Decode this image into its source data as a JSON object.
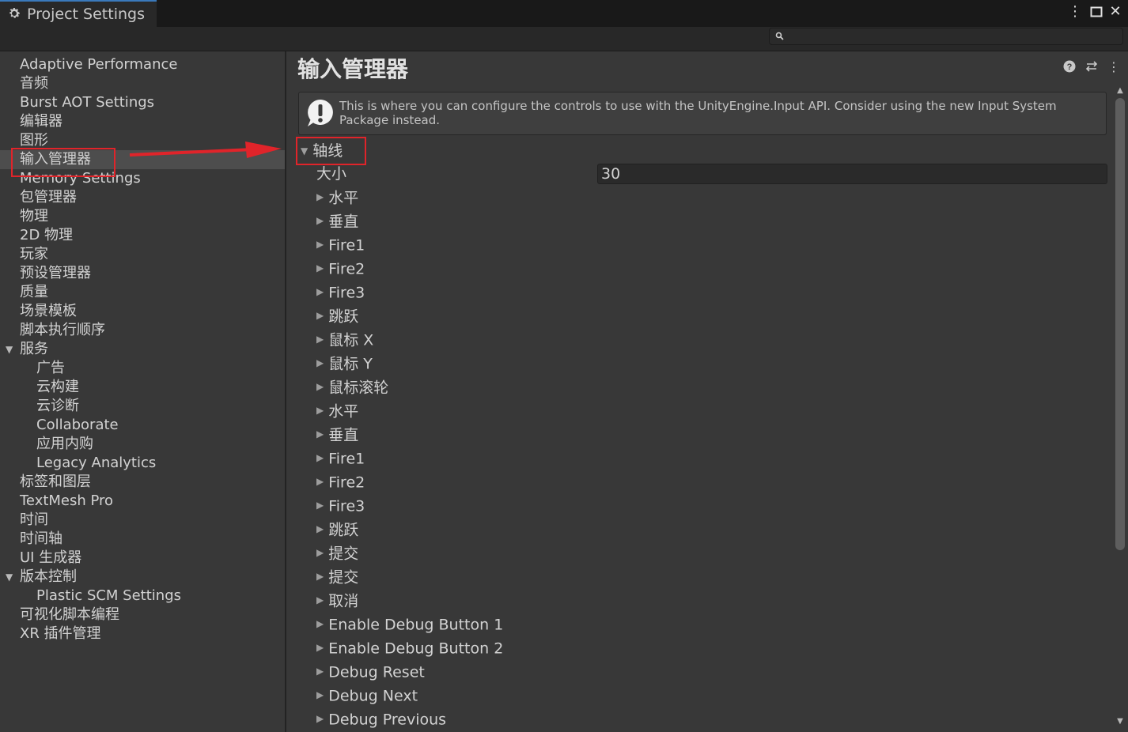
{
  "window": {
    "title": "Project Settings",
    "menu_icon": "more-vertical-icon",
    "maximize_icon": "maximize-icon",
    "close_icon": "close-icon"
  },
  "search": {
    "placeholder": "",
    "icon": "search-icon"
  },
  "sidebar": {
    "selected_index": 5,
    "items": [
      {
        "label": "Adaptive Performance",
        "level": 0
      },
      {
        "label": "音频",
        "level": 0
      },
      {
        "label": "Burst AOT Settings",
        "level": 0
      },
      {
        "label": "编辑器",
        "level": 0
      },
      {
        "label": "图形",
        "level": 0
      },
      {
        "label": "输入管理器",
        "level": 0,
        "selected": true
      },
      {
        "label": "Memory Settings",
        "level": 0
      },
      {
        "label": "包管理器",
        "level": 0
      },
      {
        "label": "物理",
        "level": 0
      },
      {
        "label": "2D 物理",
        "level": 0
      },
      {
        "label": "玩家",
        "level": 0
      },
      {
        "label": "预设管理器",
        "level": 0
      },
      {
        "label": "质量",
        "level": 0
      },
      {
        "label": "场景模板",
        "level": 0
      },
      {
        "label": "脚本执行顺序",
        "level": 0
      },
      {
        "label": "服务",
        "level": 0,
        "expanded": true
      },
      {
        "label": "广告",
        "level": 1
      },
      {
        "label": "云构建",
        "level": 1
      },
      {
        "label": "云诊断",
        "level": 1
      },
      {
        "label": "Collaborate",
        "level": 1
      },
      {
        "label": "应用内购",
        "level": 1
      },
      {
        "label": "Legacy Analytics",
        "level": 1
      },
      {
        "label": "标签和图层",
        "level": 0
      },
      {
        "label": "TextMesh Pro",
        "level": 0
      },
      {
        "label": "时间",
        "level": 0
      },
      {
        "label": "时间轴",
        "level": 0
      },
      {
        "label": "UI 生成器",
        "level": 0
      },
      {
        "label": "版本控制",
        "level": 0,
        "expanded": true
      },
      {
        "label": "Plastic SCM Settings",
        "level": 1
      },
      {
        "label": "可视化脚本编程",
        "level": 0
      },
      {
        "label": "XR 插件管理",
        "level": 0
      }
    ]
  },
  "main": {
    "title": "输入管理器",
    "header_icons": [
      "help-icon",
      "preset-icon",
      "more-vertical-icon"
    ],
    "help_text": "This is where you can configure the controls to use with the UnityEngine.Input API. Consider using the new Input System Package instead.",
    "axes_label": "轴线",
    "size_label": "大小",
    "size_value": "30",
    "axes": [
      "水平",
      "垂直",
      "Fire1",
      "Fire2",
      "Fire3",
      "跳跃",
      "鼠标 X",
      "鼠标 Y",
      "鼠标滚轮",
      "水平",
      "垂直",
      "Fire1",
      "Fire2",
      "Fire3",
      "跳跃",
      "提交",
      "提交",
      "取消",
      "Enable Debug Button 1",
      "Enable Debug Button 2",
      "Debug Reset",
      "Debug Next",
      "Debug Previous"
    ]
  },
  "colors": {
    "background": "#383838",
    "annotation": "#e0242a",
    "selected_row": "#4d4d4d",
    "tab_accent": "#3a79bb"
  }
}
